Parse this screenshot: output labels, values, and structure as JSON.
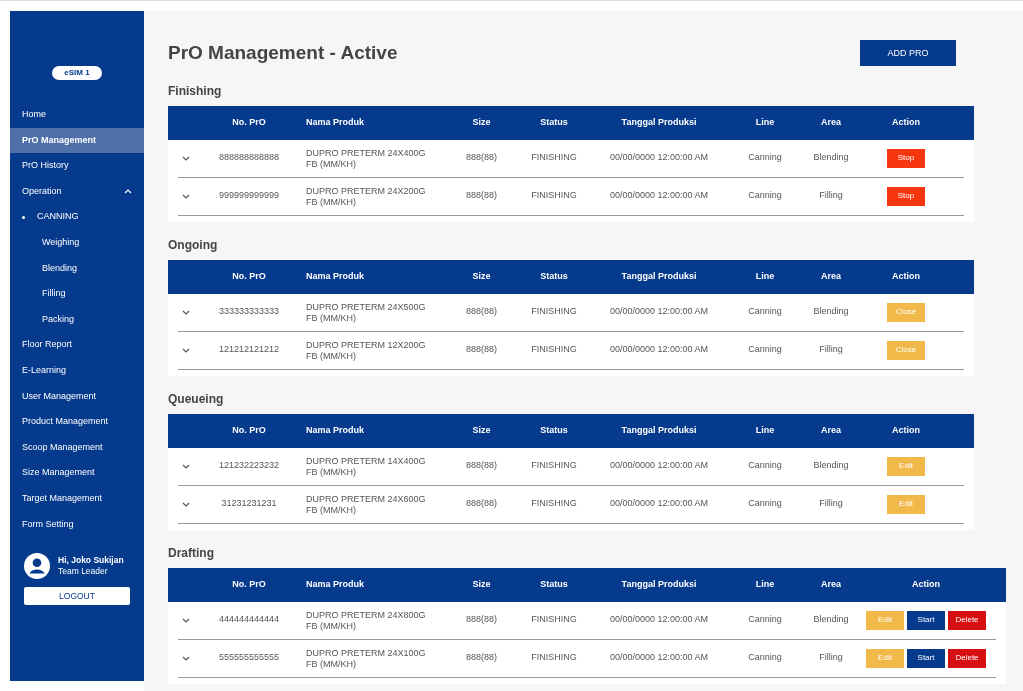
{
  "sidebar": {
    "badge": "eSIM 1",
    "items": [
      {
        "label": "Home",
        "selected": false
      },
      {
        "label": "PrO Management",
        "selected": true
      },
      {
        "label": "PrO History",
        "selected": false
      },
      {
        "label": "Operation",
        "selected": false,
        "expanded": true,
        "children": [
          {
            "label": "CANNING",
            "selected": false,
            "expanded": true,
            "children": [
              {
                "label": "Weighing",
                "selected": false
              },
              {
                "label": "Blending",
                "selected": false
              },
              {
                "label": "Filling",
                "selected": false
              },
              {
                "label": "Packing",
                "selected": false
              }
            ]
          }
        ]
      },
      {
        "label": "Floor Report",
        "selected": false
      },
      {
        "label": "E-Learning",
        "selected": false
      },
      {
        "label": "User Management",
        "selected": false
      },
      {
        "label": "Product Management",
        "selected": false
      },
      {
        "label": "Scoop Management",
        "selected": false
      },
      {
        "label": "Size Management",
        "selected": false
      },
      {
        "label": "Target Management",
        "selected": false
      },
      {
        "label": "Form Setting",
        "selected": false
      }
    ],
    "user": {
      "greeting": "Hi, Joko Sukijan",
      "role": "Team Leader"
    },
    "logout": "LOGOUT"
  },
  "page": {
    "title": "PrO Management - Active",
    "add_button": "ADD PRO"
  },
  "sections": [
    {
      "title": "Finishing",
      "columns": [
        "No. PrO",
        "Nama Produk",
        "Size",
        "Status",
        "Tanggal Produksi",
        "Line",
        "Area",
        "Action"
      ],
      "rows": [
        {
          "no": "888888888888",
          "product": "DUPRO PRETERM 24X400G FB (MM/KH)",
          "size": "888(88)",
          "status": "FINISHING",
          "date": "00/00/0000 12:00:00 AM",
          "line": "Canning",
          "area": "Blending",
          "actions": [
            {
              "kind": "stop",
              "label": "Stop"
            }
          ]
        },
        {
          "no": "999999999999",
          "product": "DUPRO PRETERM 24X200G FB (MM/KH)",
          "size": "888(88)",
          "status": "FINISHING",
          "date": "00/00/0000 12:00:00 AM",
          "line": "Canning",
          "area": "Filling",
          "actions": [
            {
              "kind": "stop",
              "label": "Stop"
            }
          ]
        }
      ]
    },
    {
      "title": "Ongoing",
      "columns": [
        "No. PrO",
        "Nama Produk",
        "Size",
        "Status",
        "Tanggal Produksi",
        "Line",
        "Area",
        "Action"
      ],
      "rows": [
        {
          "no": "333333333333",
          "product": "DUPRO PRETERM 24X500G FB (MM/KH)",
          "size": "888(88)",
          "status": "FINISHING",
          "date": "00/00/0000 12:00:00 AM",
          "line": "Canning",
          "area": "Blending",
          "actions": [
            {
              "kind": "close",
              "label": "Close"
            }
          ]
        },
        {
          "no": "121212121212",
          "product": "DUPRO PRETERM 12X200G FB (MM/KH)",
          "size": "888(88)",
          "status": "FINISHING",
          "date": "00/00/0000 12:00:00 AM",
          "line": "Canning",
          "area": "Filling",
          "actions": [
            {
              "kind": "close",
              "label": "Close"
            }
          ]
        }
      ]
    },
    {
      "title": "Queueing",
      "columns": [
        "No. PrO",
        "Nama Produk",
        "Size",
        "Status",
        "Tanggal Produksi",
        "Line",
        "Area",
        "Action"
      ],
      "rows": [
        {
          "no": "121232223232",
          "product": "DUPRO PRETERM 14X400G FB (MM/KH)",
          "size": "888(88)",
          "status": "FINISHING",
          "date": "00/00/0000 12:00:00 AM",
          "line": "Canning",
          "area": "Blending",
          "actions": [
            {
              "kind": "edit",
              "label": "Edit"
            }
          ]
        },
        {
          "no": "31231231231",
          "product": "DUPRO PRETERM 24X600G FB (MM/KH)",
          "size": "888(88)",
          "status": "FINISHING",
          "date": "00/00/0000 12:00:00 AM",
          "line": "Canning",
          "area": "Filling",
          "actions": [
            {
              "kind": "edit",
              "label": "Edit"
            }
          ]
        }
      ]
    },
    {
      "title": "Drafting",
      "columns": [
        "No. PrO",
        "Nama Produk",
        "Size",
        "Status",
        "Tanggal Produksi",
        "Line",
        "Area",
        "Action"
      ],
      "rows": [
        {
          "no": "444444444444",
          "product": "DUPRO PRETERM 24X800G FB (MM/KH)",
          "size": "888(88)",
          "status": "FINISHING",
          "date": "00/00/0000 12:00:00 AM",
          "line": "Canning",
          "area": "Blending",
          "actions": [
            {
              "kind": "edit",
              "label": "Edit"
            },
            {
              "kind": "start",
              "label": "Start"
            },
            {
              "kind": "delete",
              "label": "Delete"
            }
          ]
        },
        {
          "no": "555555555555",
          "product": "DUPRO PRETERM 24X100G FB (MM/KH)",
          "size": "888(88)",
          "status": "FINISHING",
          "date": "00/00/0000 12:00:00 AM",
          "line": "Canning",
          "area": "Filling",
          "actions": [
            {
              "kind": "edit",
              "label": "Edit"
            },
            {
              "kind": "start",
              "label": "Start"
            },
            {
              "kind": "delete",
              "label": "Delete"
            }
          ]
        }
      ]
    }
  ]
}
